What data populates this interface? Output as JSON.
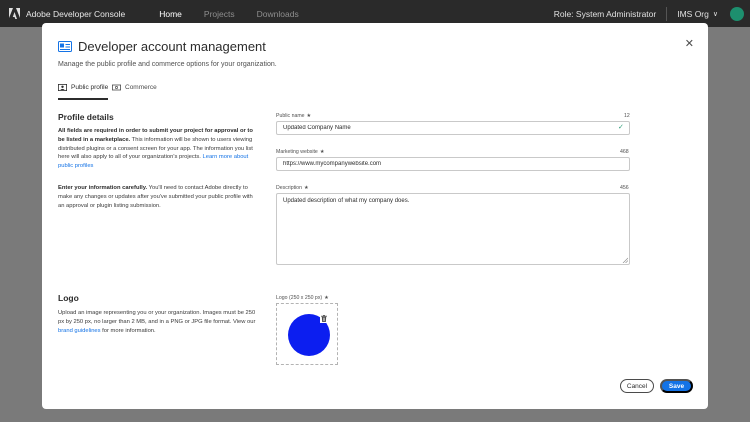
{
  "topbar": {
    "app_title": "Adobe Developer Console",
    "nav": [
      "Home",
      "Projects",
      "Downloads"
    ],
    "role": "Role: System Administrator",
    "org": "IMS Org"
  },
  "modal": {
    "title": "Developer account management",
    "subtitle": "Manage the public profile and commerce options for your organization.",
    "tabs": [
      {
        "label": "Public profile",
        "active": true
      },
      {
        "label": "Commerce",
        "active": false
      }
    ],
    "profile": {
      "heading": "Profile details",
      "para1_bold": "All fields are required in order to submit your project for approval or to be listed in a marketplace.",
      "para1_rest": " This information will be shown to users viewing distributed plugins or a consent screen for your app. The information you list here will also apply to all of your organization's projects. ",
      "para1_link": "Learn more about public profiles",
      "para2_bold": "Enter your information carefully.",
      "para2_rest": " You'll need to contact Adobe directly to make any changes or updates after you've submitted your public profile with an approval or plugin listing submission."
    },
    "fields": {
      "public_name": {
        "label": "Public name",
        "counter": "12",
        "value": "Updated Company Name"
      },
      "website": {
        "label": "Marketing website",
        "counter": "468",
        "value": "https://www.mycompanywebsite.com"
      },
      "description": {
        "label": "Description",
        "counter": "456",
        "value": "Updated description of what my company does."
      }
    },
    "logo": {
      "heading": "Logo",
      "para_text": "Upload an image representing you or your organization. Images must be 250 px by 250 px, no larger than 2 MB, and in a PNG or JPG file format. View our ",
      "para_link": "brand guidelines",
      "para_end": " for more information.",
      "field_label": "Logo (250 x 250 px)",
      "logo_color": "#0c1ef0"
    },
    "buttons": {
      "cancel": "Cancel",
      "save": "Save"
    }
  },
  "colors": {
    "accent": "#1473e6",
    "topbar": "#2a2a2a",
    "success": "#2d9d78",
    "avatar": "#1d8f6e"
  }
}
